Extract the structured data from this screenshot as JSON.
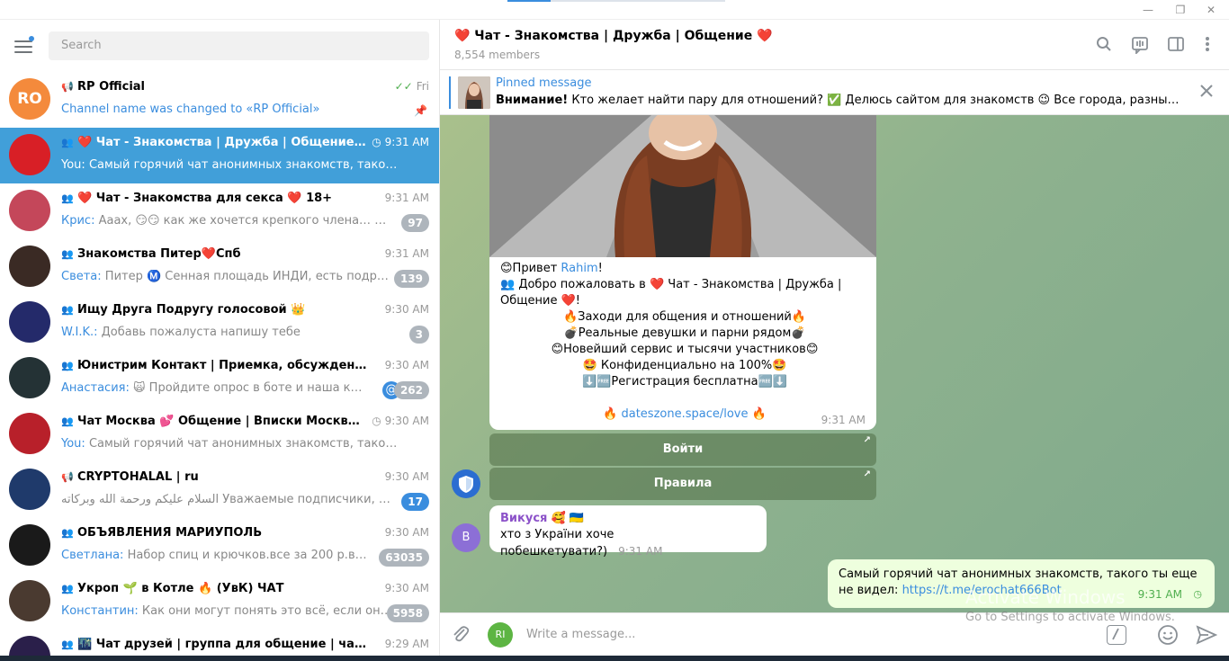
{
  "window": {
    "minimize": "—",
    "restore": "❐",
    "close": "✕"
  },
  "search": {
    "placeholder": "Search"
  },
  "chats": [
    {
      "avatar_text": "RO",
      "avatar_color": "#f48a3c",
      "kind": "channel",
      "title": "RP Official",
      "time": "Fri",
      "sender": "",
      "preview": "Channel name was changed to «RP Official»",
      "preview_color": "#3a8dde",
      "badge": "",
      "pinned": true,
      "read": true
    },
    {
      "avatar_text": "",
      "avatar_color": "#d81f26",
      "kind": "group",
      "title": "❤️ Чат - Знакомства | Дружба | Общение ❤️",
      "time": "9:31 AM",
      "sender": "You:",
      "preview": "Самый горячий чат анонимных знакомств, такого ты еще …",
      "badge": "",
      "active": true,
      "clock": true
    },
    {
      "avatar_text": "",
      "avatar_color": "#c4475a",
      "kind": "group",
      "title": "❤️ Чат - Знакомства для секса ❤️ 18+",
      "time": "9:31 AM",
      "sender": "Крис:",
      "preview": "Ааах, 😏😏 как же хочется крепкого члена… ☺️ У теб…",
      "badge": "97"
    },
    {
      "avatar_text": "",
      "avatar_color": "#3a2a24",
      "kind": "group",
      "title": "Знакомства Питер❤️Спб",
      "time": "9:31 AM",
      "sender": "Света:",
      "preview": "Питер Ⓜ️ Сенная площадь  ИНДИ, есть подруга, не …",
      "badge": "139"
    },
    {
      "avatar_text": "",
      "avatar_color": "#242a6a",
      "kind": "group",
      "title": "Ищу Друга Подругу голосовой 👑",
      "time": "9:30 AM",
      "sender": "W.I.K.:",
      "preview": "Добавь пожалуста напишу тебе",
      "badge": "3"
    },
    {
      "avatar_text": "",
      "avatar_color": "#243235",
      "kind": "group",
      "title": "Юнистрим Контакт | Приемка, обсуждение",
      "time": "9:30 AM",
      "sender": "Анастасия:",
      "preview": "🙀 Пройдите опрос в боте и наша команда …",
      "badge": "262",
      "mention": true
    },
    {
      "avatar_text": "",
      "avatar_color": "#b8202a",
      "kind": "group",
      "title": "Чат Москва 💕 Общение | Вписки Москвы | З…",
      "time": "9:30 AM",
      "sender": "You:",
      "preview": "Самый горячий чат анонимных знакомств, такого ты еще …",
      "badge": "",
      "clock": true
    },
    {
      "avatar_text": "",
      "avatar_color": "#1f3a6b",
      "kind": "channel",
      "title": "CRYPTOHALAL | ru",
      "time": "9:30 AM",
      "sender": "",
      "preview": "السلام عليكم ورحمة الله وبركاته  Уважаемые подписчики, ваши б…",
      "badge": "17",
      "badge_blue": true
    },
    {
      "avatar_text": "",
      "avatar_color": "#1a1a1a",
      "kind": "group",
      "title": "ОБЪЯВЛЕНИЯ МАРИУПОЛЬ",
      "time": "9:30 AM",
      "sender": "Светлана:",
      "preview": "Набор спиц и крючков.все за 200 р.в…",
      "badge": "63035"
    },
    {
      "avatar_text": "",
      "avatar_color": "#4a3a30",
      "kind": "group",
      "title": "Укроп 🌱 в Котле 🔥 (УвК) ЧАТ",
      "time": "9:30 AM",
      "sender": "Константин:",
      "preview": "Как они могут понять это всё, если они всег…",
      "badge": "5958"
    },
    {
      "avatar_text": "",
      "avatar_color": "#2a1f4a",
      "kind": "group",
      "title": "🌃 Чат друзей | группа для общение | чат для…",
      "time": "9:29 AM",
      "sender": "",
      "preview": "",
      "badge": ""
    }
  ],
  "header": {
    "title": "❤️ Чат - Знакомства | Дружба | Общение ❤️",
    "members": "8,554 members"
  },
  "pinned": {
    "label": "Pinned message",
    "bold": "Внимание!",
    "text": " Кто желает найти пару для отношений? ✅ Делюсь сайтом для знакомств 😉 Все города, разные страны …"
  },
  "message": {
    "greet": "😊Привет ",
    "greet_name": "Rahim",
    "greet_end": "!",
    "welcome": "👥 Добро пожаловать в ❤️ Чат - Знакомства | Дружба | Общение ❤️!",
    "lines": [
      "🔥Заходи для общения и отношений🔥",
      "💣Реальные девушки и парни рядом💣",
      "😊Новейший сервис и тысячи участников😊",
      "🤩 Конфиденциально на 100%🤩",
      "⬇️🆓Регистрация бесплатна🆓⬇️"
    ],
    "link_pre": "🔥 ",
    "link": "dateszone.space/love",
    "link_post": " 🔥",
    "time": "9:31 AM"
  },
  "buttons": {
    "login": "Войти",
    "rules": "Правила"
  },
  "incoming": {
    "avatar": "В",
    "name": "Викуся",
    "name_suffix": " 🥰 🇺🇦",
    "text": "хто з України хоче побешкетувати?)",
    "time": "9:31 AM"
  },
  "outgoing": {
    "text": "Самый горячий чат анонимных знакомств, такого ты еще не видел: ",
    "link": "https://t.me/erochat666Bot",
    "time": "9:31 AM"
  },
  "composer": {
    "avatar": "RI",
    "placeholder": "Write a message..."
  },
  "watermark": {
    "title": "Activate Windows",
    "sub": "Go to Settings to activate Windows."
  },
  "colors": {
    "accent": "#419fd9",
    "link": "#3a8dde",
    "outgoing_bubble": "#eeffde"
  }
}
